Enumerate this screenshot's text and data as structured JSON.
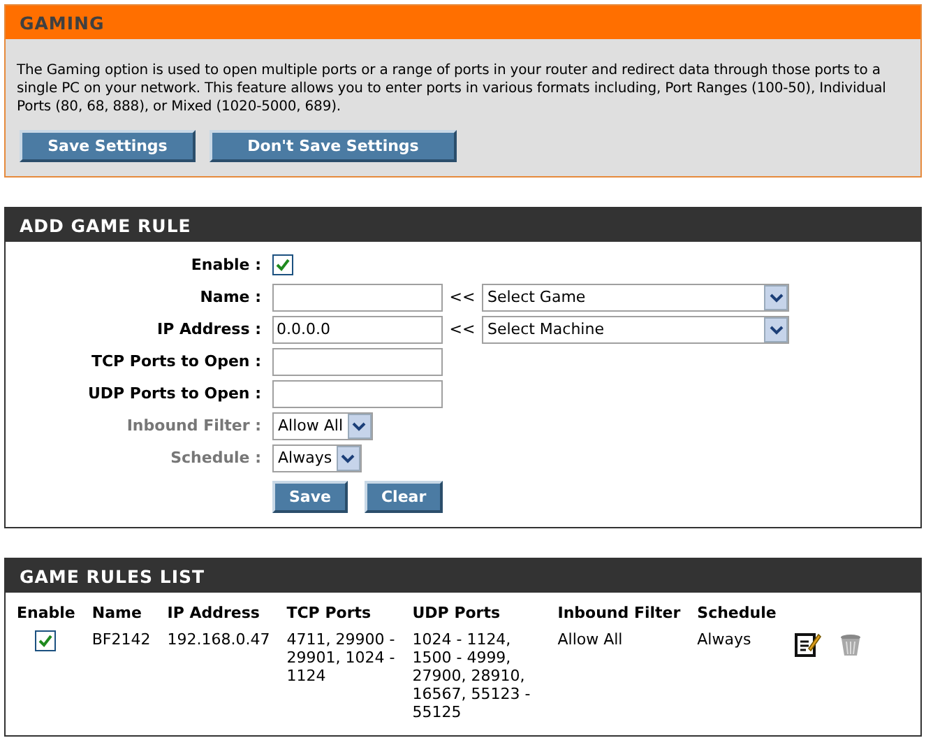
{
  "gaming": {
    "title": "GAMING",
    "description": "The Gaming option is used to open multiple ports or a range of ports in your router and redirect data through those ports to a single PC on your network. This feature allows you to enter ports in various formats including, Port Ranges (100-50), Individual Ports (80, 68, 888), or Mixed (1020-5000, 689).",
    "buttons": [
      "Save Settings",
      "Don't Save Settings"
    ]
  },
  "add_rule": {
    "title": "ADD GAME RULE",
    "fields": [
      {
        "kind": "checkbox",
        "label": "Enable :",
        "dimmed": false,
        "checked": true
      },
      {
        "kind": "text_select",
        "label": "Name :",
        "dimmed": false,
        "arrow": "<<",
        "select": "Select Game"
      },
      {
        "kind": "text_select",
        "label": "IP Address :",
        "dimmed": false,
        "value": "0.0.0.0",
        "arrow": "<<",
        "select": "Select Machine"
      },
      {
        "kind": "text",
        "label": "TCP Ports to Open :",
        "dimmed": false
      },
      {
        "kind": "text",
        "label": "UDP Ports to Open :",
        "dimmed": false
      },
      {
        "kind": "small_select",
        "label": "Inbound Filter :",
        "dimmed": true,
        "select": "Allow All"
      },
      {
        "kind": "small_select",
        "label": "Schedule :",
        "dimmed": true,
        "select": "Always"
      }
    ],
    "buttons": [
      "Save",
      "Clear"
    ]
  },
  "rules_list": {
    "title": "GAME RULES LIST",
    "columns": [
      "Enable",
      "Name",
      "IP Address",
      "TCP Ports",
      "UDP Ports",
      "Inbound Filter",
      "Schedule"
    ],
    "rows": [
      {
        "enabled": true,
        "name": "BF2142",
        "ip": "192.168.0.47",
        "tcp": "4711, 29900 - 29901, 1024 - 1124",
        "udp": "1024 - 1124, 1500 - 4999, 27900, 28910, 16567, 55123 - 55125",
        "filter": "Allow All",
        "schedule": "Always"
      }
    ]
  }
}
